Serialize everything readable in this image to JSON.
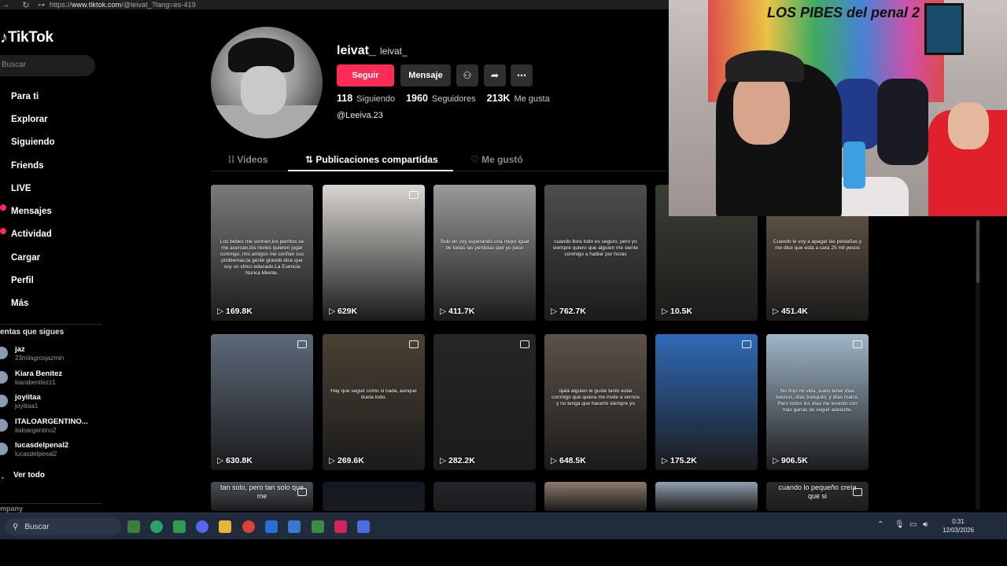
{
  "browser": {
    "url_prefix": "https://",
    "url_host": "www.tiktok.com",
    "url_path": "/@leivat_?lang=es-419"
  },
  "sidebar": {
    "logo": "TikTok",
    "search_placeholder": "Buscar",
    "nav": [
      {
        "label": "Para ti",
        "icon": "home-icon",
        "badge": false
      },
      {
        "label": "Explorar",
        "icon": "compass-icon",
        "badge": false
      },
      {
        "label": "Siguiendo",
        "icon": "following-icon",
        "badge": false
      },
      {
        "label": "Friends",
        "icon": "friends-icon",
        "badge": false
      },
      {
        "label": "LIVE",
        "icon": "live-icon",
        "badge": false
      },
      {
        "label": "Mensajes",
        "icon": "message-icon",
        "badge": true
      },
      {
        "label": "Actividad",
        "icon": "bell-icon",
        "badge": true
      },
      {
        "label": "Cargar",
        "icon": "upload-icon",
        "badge": false
      },
      {
        "label": "Perfil",
        "icon": "profile-icon",
        "badge": false
      },
      {
        "label": "Más",
        "icon": "more-icon",
        "badge": false
      }
    ],
    "following_title": "entas que sigues",
    "following": [
      {
        "name": "jaz",
        "handle": "23milagrosjazmin"
      },
      {
        "name": "Kiara Benitez",
        "handle": "kiarabenitezz1"
      },
      {
        "name": "joyiitaa",
        "handle": "joyiitaa1"
      },
      {
        "name": "ITALOARGENTINO...",
        "handle": "italoargentino2"
      },
      {
        "name": "lucasdelpenal2",
        "handle": "lucasdelpenal2"
      }
    ],
    "see_all": "Ver todo",
    "company": "mpany"
  },
  "profile": {
    "username": "leivat_",
    "nickname": "leivat_",
    "follow_btn": "Seguir",
    "message_btn": "Mensaje",
    "following_count": "118",
    "following_label": "Siguiendo",
    "followers_count": "1960",
    "followers_label": "Seguidores",
    "likes_count": "213K",
    "likes_label": "Me gusta",
    "bio": "@Leeiva.23"
  },
  "tabs": [
    {
      "label": "Videos",
      "active": false
    },
    {
      "label": "Publicaciones compartidas",
      "active": true
    },
    {
      "label": "Me gustó",
      "active": false
    }
  ],
  "videos": [
    {
      "views": "169.8K",
      "caption": "Los bebes me sonrien,los perritos se me acercan,los nenes quieren jugar conmigo, mis amigos me confian sus problemas,la gente grande dice que soy un chico educado.La Esencia Nunca Miente.",
      "bg": "#7b7b7b",
      "pin": false
    },
    {
      "views": "629K",
      "caption": "",
      "bg": "#d9d6d2",
      "pin": true
    },
    {
      "views": "411.7K",
      "caption": "Solo en voy esperando una mejor igual de todas las perdidas que yo paso",
      "bg": "#9a9a9c",
      "pin": false
    },
    {
      "views": "762.7K",
      "caption": "cuando llora todo es seguro, pero yo siempre quiero que alguien me siente conmigo a hablar por horas",
      "bg": "#4e4e50",
      "pin": false
    },
    {
      "views": "10.5K",
      "caption": "",
      "bg": "#3a3f33",
      "pin": false
    },
    {
      "views": "451.4K",
      "caption": "Cuando le voy a apagar las pestañas y me dice que está a cara 25 mil pesos",
      "bg": "#6e5e4c",
      "pin": false
    },
    {
      "views": "630.8K",
      "caption": "",
      "bg": "#5d6a7a",
      "pin": true
    },
    {
      "views": "269.6K",
      "caption": "Hay que seguir como si nada, aunque duela todo.",
      "bg": "#4b4133",
      "pin": true
    },
    {
      "views": "282.2K",
      "caption": "",
      "bg": "#262626",
      "pin": true
    },
    {
      "views": "648.5K",
      "caption": "ojalá alguien le guste tanto estar conmigo que quiera me invite a vernos y no tenga que hacerlo siempre yo",
      "bg": "#5c5148",
      "pin": false
    },
    {
      "views": "175.2K",
      "caption": "",
      "bg": "#2f6ab8",
      "pin": true
    },
    {
      "views": "906.5K",
      "caption": "No finjo mi vida, suelo tener días buenos, días tranquilo, y días malos. Pero todos los días me levanto con más ganas de seguir adelante.",
      "bg": "#9fb6c7",
      "pin": true
    },
    {
      "views": "",
      "caption": "tan solo, pero tan solo que me",
      "bg": "#4c525a",
      "pin": true
    },
    {
      "views": "",
      "caption": "",
      "bg": "#111827",
      "pin": false
    },
    {
      "views": "",
      "caption": "",
      "bg": "#23252c",
      "pin": false
    },
    {
      "views": "",
      "caption": "",
      "bg": "#8a7a6c",
      "pin": false
    },
    {
      "views": "",
      "caption": "",
      "bg": "#8fa0ad",
      "pin": false
    },
    {
      "views": "",
      "caption": "cuando lo pequeño creía que si",
      "bg": "#2c2c2c",
      "pin": true
    }
  ],
  "taskbar": {
    "search": "Buscar",
    "time": "0:31",
    "date": "12/03/2026"
  },
  "webcam": {
    "graffiti": "LOS PIBES del penal 2"
  }
}
